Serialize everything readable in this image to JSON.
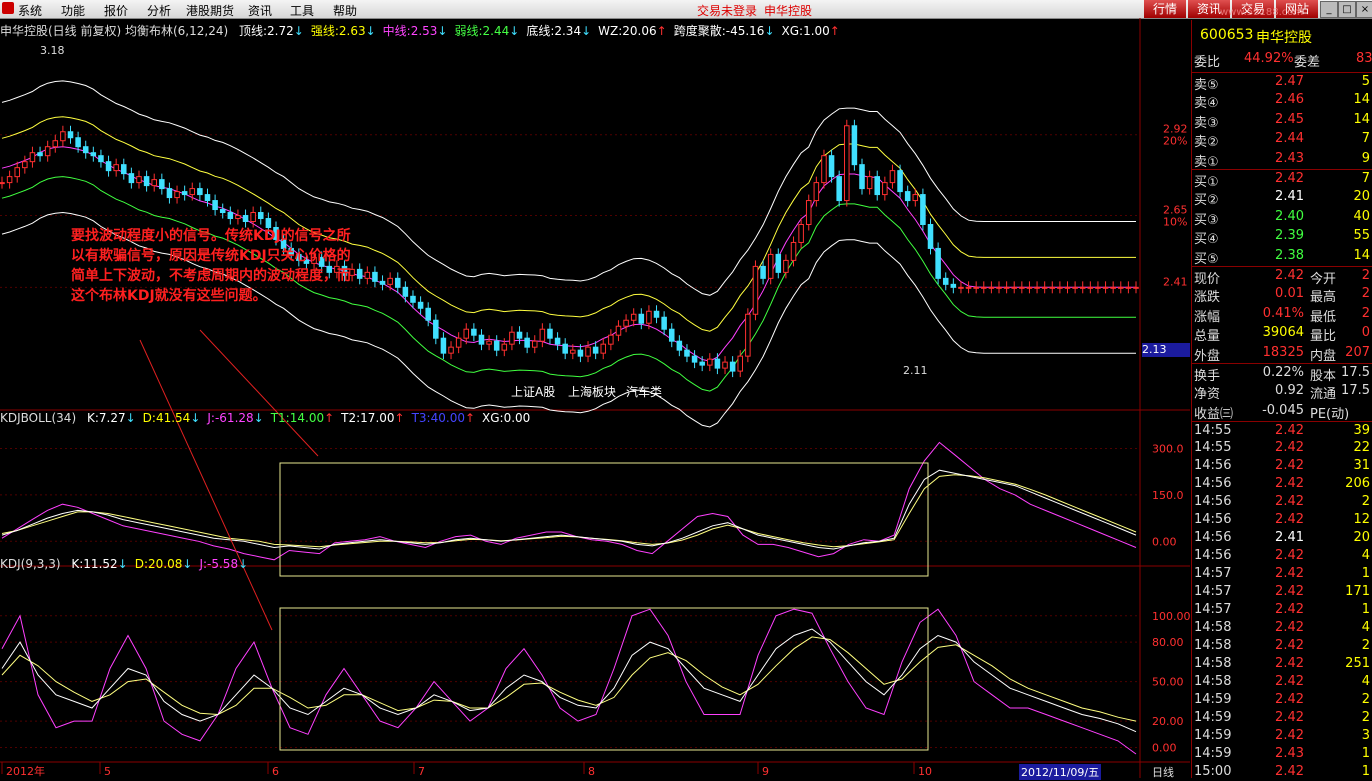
{
  "menubar": {
    "items": [
      "系统",
      "功能",
      "报价",
      "分析",
      "港股期货",
      "资讯",
      "工具",
      "帮助"
    ],
    "login_status": "交易未登录",
    "stock_short": "申华控股",
    "tabs": [
      "行情",
      "资讯",
      "交易",
      "网站"
    ],
    "watermark": "www.55188.com"
  },
  "main_chart": {
    "header": {
      "title": "申华控股(日线 前复权) 均衡布林(6,12,24)",
      "fields": [
        {
          "label": "顶线:",
          "value": "2.72",
          "arrow": "↓",
          "color": "#ffffff"
        },
        {
          "label": "强线:",
          "value": "2.63",
          "arrow": "↓",
          "color": "#ffff00"
        },
        {
          "label": "中线:",
          "value": "2.53",
          "arrow": "↓",
          "color": "#ff44ff"
        },
        {
          "label": "弱线:",
          "value": "2.44",
          "arrow": "↓",
          "color": "#44ff44"
        },
        {
          "label": "底线:",
          "value": "2.34",
          "arrow": "↓",
          "color": "#ffffff"
        },
        {
          "label": "WZ:",
          "value": "20.06",
          "arrow": "↑",
          "color": "#ffffff"
        },
        {
          "label": "跨度聚散:",
          "value": "-45.16",
          "arrow": "↓",
          "color": "#ffffff"
        },
        {
          "label": "XG:",
          "value": "1.00",
          "arrow": "↑",
          "color": "#ffffff"
        }
      ]
    },
    "price_axis": [
      {
        "price": "2.92",
        "pct": "20%",
        "v": 2.92
      },
      {
        "price": "2.65",
        "pct": "10%",
        "v": 2.65
      },
      {
        "price": "2.41",
        "pct": "",
        "v": 2.41
      }
    ],
    "current_price_tag": "2.13",
    "high_label": "3.18",
    "low_label": "2.11",
    "links": [
      "上证A股",
      "上海板块",
      "汽车类"
    ],
    "annotation": "要找波动程度小的信号。传统KDJ的信号之所以有欺骗信号，原因是传统KDJ只关心价格的简单上下波动，不考虑周期内的波动程度，而这个布林KDJ就没有这些问题。"
  },
  "kdjboll_panel": {
    "header_name": "KDJBOLL(34)",
    "fields": [
      {
        "label": "K:",
        "value": "7.27",
        "arrow": "↓",
        "color": "#ffffff"
      },
      {
        "label": "D:",
        "value": "41.54",
        "arrow": "↓",
        "color": "#ffff00"
      },
      {
        "label": "J:",
        "value": "-61.28",
        "arrow": "↓",
        "color": "#ff44ff"
      },
      {
        "label": "T1:",
        "value": "14.00",
        "arrow": "↑",
        "color": "#44ff44"
      },
      {
        "label": "T2:",
        "value": "17.00",
        "arrow": "↑",
        "color": "#ffffff"
      },
      {
        "label": "T3:",
        "value": "40.00",
        "arrow": "↑",
        "color": "#4444ff"
      },
      {
        "label": "XG:",
        "value": "0.00",
        "arrow": "",
        "color": "#ffffff"
      }
    ],
    "axis": [
      {
        "label": "300.0",
        "v": 300
      },
      {
        "label": "150.0",
        "v": 150
      },
      {
        "label": "0.00",
        "v": 0
      }
    ]
  },
  "kdj_panel": {
    "header_name": "KDJ(9,3,3)",
    "fields": [
      {
        "label": "K:",
        "value": "11.52",
        "arrow": "↓",
        "color": "#ffffff"
      },
      {
        "label": "D:",
        "value": "20.08",
        "arrow": "↓",
        "color": "#ffff00"
      },
      {
        "label": "J:",
        "value": "-5.58",
        "arrow": "↓",
        "color": "#ff44ff"
      }
    ],
    "axis": [
      {
        "label": "100.00",
        "v": 100
      },
      {
        "label": "80.00",
        "v": 80
      },
      {
        "label": "50.00",
        "v": 50
      },
      {
        "label": "20.00",
        "v": 20
      },
      {
        "label": "0.00",
        "v": 0
      }
    ]
  },
  "time_axis": {
    "labels": [
      "2012年",
      "5",
      "6",
      "7",
      "8",
      "9",
      "10"
    ],
    "cursor_date": "2012/11/09/五",
    "period": "日线"
  },
  "chart_data": {
    "type": "line",
    "x": [
      0,
      1,
      2,
      3,
      4,
      5,
      6,
      7,
      8,
      9,
      10,
      11,
      12,
      13,
      14,
      15,
      16,
      17,
      18,
      19,
      20,
      21,
      22,
      23,
      24,
      25,
      26,
      27,
      28,
      29,
      30,
      31,
      32,
      33,
      34,
      35,
      36,
      37,
      38,
      39,
      40,
      41,
      42,
      43,
      44,
      45,
      46,
      47,
      48,
      49,
      50,
      51,
      52,
      53,
      54,
      55,
      56,
      57,
      58,
      59,
      60,
      61,
      62,
      63,
      64,
      65,
      66,
      67,
      68,
      69,
      70,
      71,
      72,
      73,
      74,
      75,
      76,
      77,
      78,
      79,
      80,
      81,
      82,
      83,
      84,
      85,
      86,
      87,
      88,
      89,
      90,
      91,
      92,
      93,
      94,
      95,
      96,
      97,
      98,
      99,
      100,
      101,
      102,
      103,
      104,
      105,
      106,
      107,
      108,
      109,
      110,
      111,
      112,
      113,
      114,
      115,
      116,
      117,
      118,
      119,
      120,
      121,
      122,
      123,
      124,
      125,
      126,
      127,
      128,
      129,
      130,
      131,
      132,
      133,
      134,
      135,
      136,
      137,
      138,
      139,
      140,
      141,
      142,
      143,
      144,
      145,
      146,
      147,
      148,
      149
    ],
    "series": [
      {
        "name": "收盘",
        "values": [
          2.76,
          2.78,
          2.81,
          2.83,
          2.86,
          2.85,
          2.88,
          2.9,
          2.93,
          2.91,
          2.88,
          2.86,
          2.85,
          2.83,
          2.8,
          2.82,
          2.79,
          2.76,
          2.78,
          2.75,
          2.77,
          2.74,
          2.71,
          2.73,
          2.72,
          2.74,
          2.72,
          2.7,
          2.67,
          2.66,
          2.64,
          2.65,
          2.63,
          2.66,
          2.64,
          2.61,
          2.57,
          2.54,
          2.52,
          2.5,
          2.49,
          2.51,
          2.48,
          2.46,
          2.48,
          2.45,
          2.47,
          2.44,
          2.46,
          2.43,
          2.42,
          2.44,
          2.41,
          2.38,
          2.36,
          2.34,
          2.3,
          2.24,
          2.19,
          2.21,
          2.24,
          2.27,
          2.25,
          2.22,
          2.23,
          2.2,
          2.22,
          2.26,
          2.24,
          2.21,
          2.23,
          2.27,
          2.24,
          2.22,
          2.19,
          2.2,
          2.18,
          2.21,
          2.19,
          2.22,
          2.25,
          2.28,
          2.3,
          2.32,
          2.29,
          2.33,
          2.31,
          2.27,
          2.23,
          2.2,
          2.18,
          2.16,
          2.15,
          2.17,
          2.14,
          2.16,
          2.13,
          2.18,
          2.32,
          2.48,
          2.44,
          2.52,
          2.46,
          2.5,
          2.56,
          2.62,
          2.7,
          2.76,
          2.85,
          2.78,
          2.7,
          2.95,
          2.82,
          2.74,
          2.78,
          2.72,
          2.76,
          2.8,
          2.73,
          2.7,
          2.72,
          2.62,
          2.54,
          2.44,
          2.42,
          2.41,
          2.41,
          2.41,
          2.41,
          2.41,
          2.41,
          2.41,
          2.41,
          2.41,
          2.41,
          2.41,
          2.41,
          2.41,
          2.41,
          2.41,
          2.41,
          2.41,
          2.41,
          2.41,
          2.41,
          2.41,
          2.41,
          2.41,
          2.41,
          2.41
        ]
      }
    ],
    "ylim": [
      2.0,
      3.25
    ],
    "kdjboll": {
      "k": [
        20,
        35,
        55,
        75,
        90,
        100,
        95,
        85,
        70,
        60,
        50,
        40,
        30,
        20,
        10,
        5,
        0,
        -10,
        -20,
        -15,
        -20,
        -25,
        -10,
        -5,
        0,
        5,
        0,
        -5,
        -10,
        -5,
        5,
        10,
        5,
        0,
        5,
        10,
        15,
        20,
        15,
        10,
        5,
        0,
        -10,
        -15,
        -5,
        10,
        30,
        50,
        60,
        40,
        20,
        10,
        0,
        -10,
        -20,
        -25,
        -15,
        -5,
        0,
        10,
        120,
        200,
        230,
        220,
        210,
        200,
        190,
        180,
        160,
        140,
        120,
        100,
        80,
        60,
        40,
        20
      ],
      "d": [
        25,
        35,
        50,
        65,
        80,
        95,
        95,
        90,
        80,
        70,
        60,
        50,
        40,
        30,
        20,
        10,
        5,
        0,
        -10,
        -12,
        -15,
        -18,
        -12,
        -8,
        -4,
        0,
        0,
        -2,
        -5,
        -4,
        2,
        6,
        5,
        2,
        4,
        8,
        12,
        16,
        14,
        10,
        6,
        2,
        -5,
        -10,
        -6,
        4,
        20,
        40,
        52,
        40,
        25,
        15,
        5,
        -5,
        -12,
        -18,
        -14,
        -8,
        -2,
        5,
        90,
        170,
        210,
        215,
        212,
        205,
        195,
        185,
        168,
        150,
        130,
        110,
        90,
        70,
        50,
        30
      ],
      "j": [
        10,
        40,
        70,
        100,
        120,
        110,
        90,
        70,
        50,
        40,
        30,
        20,
        10,
        0,
        -15,
        -25,
        -40,
        -50,
        -60,
        -30,
        -35,
        -40,
        -5,
        0,
        5,
        15,
        0,
        -10,
        -20,
        0,
        15,
        20,
        0,
        -10,
        10,
        20,
        30,
        30,
        15,
        5,
        0,
        -10,
        -30,
        -40,
        0,
        40,
        80,
        90,
        80,
        20,
        -10,
        -10,
        -20,
        -35,
        -50,
        -40,
        -10,
        5,
        0,
        20,
        170,
        260,
        320,
        280,
        240,
        200,
        170,
        150,
        120,
        100,
        80,
        60,
        40,
        20,
        0,
        -20
      ]
    },
    "kdj": {
      "k": [
        60,
        80,
        55,
        40,
        35,
        30,
        45,
        60,
        55,
        35,
        25,
        20,
        25,
        40,
        55,
        45,
        30,
        25,
        35,
        45,
        40,
        30,
        25,
        30,
        40,
        35,
        28,
        30,
        45,
        55,
        50,
        38,
        32,
        30,
        45,
        70,
        80,
        75,
        60,
        45,
        40,
        35,
        55,
        75,
        85,
        90,
        80,
        65,
        50,
        40,
        55,
        75,
        85,
        80,
        65,
        55,
        45,
        40,
        35,
        30,
        25,
        22,
        18,
        12
      ],
      "d": [
        55,
        70,
        62,
        50,
        42,
        35,
        40,
        50,
        52,
        42,
        32,
        26,
        25,
        32,
        45,
        45,
        38,
        30,
        32,
        40,
        40,
        34,
        28,
        30,
        36,
        35,
        30,
        30,
        38,
        48,
        49,
        42,
        36,
        32,
        38,
        55,
        68,
        72,
        66,
        55,
        46,
        40,
        48,
        62,
        75,
        84,
        82,
        72,
        60,
        48,
        52,
        65,
        76,
        78,
        70,
        62,
        52,
        45,
        40,
        35,
        30,
        27,
        23,
        20
      ],
      "j": [
        75,
        100,
        40,
        15,
        20,
        20,
        60,
        85,
        60,
        20,
        10,
        5,
        25,
        60,
        80,
        45,
        15,
        10,
        40,
        60,
        40,
        20,
        15,
        30,
        50,
        35,
        20,
        30,
        60,
        75,
        55,
        30,
        20,
        25,
        60,
        100,
        105,
        85,
        50,
        25,
        25,
        25,
        70,
        100,
        105,
        102,
        75,
        50,
        30,
        25,
        65,
        95,
        105,
        85,
        50,
        40,
        30,
        30,
        25,
        20,
        15,
        10,
        5,
        -5
      ]
    }
  },
  "quote_panel": {
    "code": "600653",
    "name": "申华控股",
    "wei_bi": {
      "label": "委比",
      "value": "44.92%",
      "label2": "委差",
      "value2": "83"
    },
    "sells": [
      {
        "label": "卖⑤",
        "price": "2.47",
        "vol": "5"
      },
      {
        "label": "卖④",
        "price": "2.46",
        "vol": "14"
      },
      {
        "label": "卖③",
        "price": "2.45",
        "vol": "14"
      },
      {
        "label": "卖②",
        "price": "2.44",
        "vol": "7"
      },
      {
        "label": "卖①",
        "price": "2.43",
        "vol": "9"
      }
    ],
    "buys": [
      {
        "label": "买①",
        "price": "2.42",
        "vol": "7"
      },
      {
        "label": "买②",
        "price": "2.41",
        "vol": "20"
      },
      {
        "label": "买③",
        "price": "2.40",
        "vol": "40"
      },
      {
        "label": "买④",
        "price": "2.39",
        "vol": "55"
      },
      {
        "label": "买⑤",
        "price": "2.38",
        "vol": "14"
      }
    ],
    "stats": [
      {
        "l1": "现价",
        "v1": "2.42",
        "c1": "#ff3030",
        "l2": "今开",
        "v2": "2"
      },
      {
        "l1": "涨跌",
        "v1": "0.01",
        "c1": "#ff3030",
        "l2": "最高",
        "v2": "2"
      },
      {
        "l1": "涨幅",
        "v1": "0.41%",
        "c1": "#ff3030",
        "l2": "最低",
        "v2": "2"
      },
      {
        "l1": "总量",
        "v1": "39064",
        "c1": "#ffff00",
        "l2": "量比",
        "v2": "0"
      },
      {
        "l1": "外盘",
        "v1": "18325",
        "c1": "#ff3030",
        "l2": "内盘",
        "v2": "207"
      }
    ],
    "stats2": [
      {
        "l1": "换手",
        "v1": "0.22%",
        "l2": "股本",
        "v2": "17.5"
      },
      {
        "l1": "净资",
        "v1": "0.92",
        "l2": "流通",
        "v2": "17.5"
      },
      {
        "l1": "收益㈢",
        "v1": "-0.045",
        "l2": "PE(动)",
        "v2": ""
      }
    ],
    "ticks": [
      {
        "time": "14:55",
        "price": "2.42",
        "vol": "39",
        "c": "#ff3030"
      },
      {
        "time": "14:55",
        "price": "2.42",
        "vol": "22",
        "c": "#ff3030"
      },
      {
        "time": "14:56",
        "price": "2.42",
        "vol": "31",
        "c": "#ff3030"
      },
      {
        "time": "14:56",
        "price": "2.42",
        "vol": "206",
        "c": "#ff3030"
      },
      {
        "time": "14:56",
        "price": "2.42",
        "vol": "2",
        "c": "#ff3030"
      },
      {
        "time": "14:56",
        "price": "2.42",
        "vol": "12",
        "c": "#ff3030"
      },
      {
        "time": "14:56",
        "price": "2.41",
        "vol": "20",
        "c": "#ffffff"
      },
      {
        "time": "14:56",
        "price": "2.42",
        "vol": "4",
        "c": "#ff3030"
      },
      {
        "time": "14:57",
        "price": "2.42",
        "vol": "1",
        "c": "#ff3030"
      },
      {
        "time": "14:57",
        "price": "2.42",
        "vol": "171",
        "c": "#ff3030"
      },
      {
        "time": "14:57",
        "price": "2.42",
        "vol": "1",
        "c": "#ff3030"
      },
      {
        "time": "14:58",
        "price": "2.42",
        "vol": "4",
        "c": "#ff3030"
      },
      {
        "time": "14:58",
        "price": "2.42",
        "vol": "2",
        "c": "#ff3030"
      },
      {
        "time": "14:58",
        "price": "2.42",
        "vol": "251",
        "c": "#ff3030"
      },
      {
        "time": "14:58",
        "price": "2.42",
        "vol": "4",
        "c": "#ff3030"
      },
      {
        "time": "14:59",
        "price": "2.42",
        "vol": "2",
        "c": "#ff3030"
      },
      {
        "time": "14:59",
        "price": "2.42",
        "vol": "2",
        "c": "#ff3030"
      },
      {
        "time": "14:59",
        "price": "2.42",
        "vol": "3",
        "c": "#ff3030"
      },
      {
        "time": "14:59",
        "price": "2.43",
        "vol": "1",
        "c": "#ff3030"
      },
      {
        "time": "15:00",
        "price": "2.42",
        "vol": "1",
        "c": "#ff3030"
      }
    ]
  }
}
